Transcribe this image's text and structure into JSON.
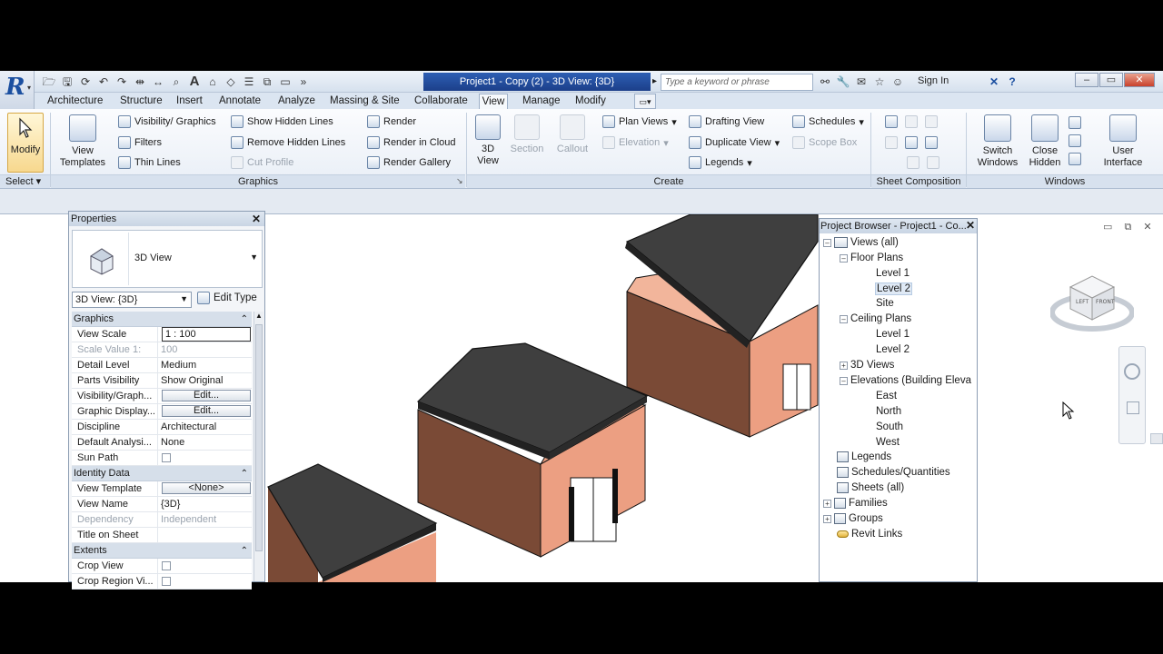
{
  "window": {
    "doc_title": "Project1 - Copy (2) - 3D View: {3D}",
    "search_placeholder": "Type a keyword or phrase",
    "signin": "Sign In"
  },
  "ribbon": {
    "tabs": [
      "Architecture",
      "Structure",
      "Insert",
      "Annotate",
      "Analyze",
      "Massing & Site",
      "Collaborate",
      "View",
      "Manage",
      "Modify"
    ],
    "select": {
      "modify": "Modify",
      "select_label": "Select"
    },
    "graphics": {
      "view_templates": "View Templates",
      "visibility_graphics": "Visibility/ Graphics",
      "filters": "Filters",
      "thin_lines": "Thin  Lines",
      "show_hidden_lines": "Show  Hidden Lines",
      "remove_hidden_lines": "Remove  Hidden Lines",
      "cut_profile": "Cut  Profile",
      "render": "Render",
      "render_in_cloud": "Render  in Cloud",
      "render_gallery": "Render  Gallery",
      "title": "Graphics"
    },
    "create": {
      "view3d": "3D View",
      "section": "Section",
      "callout": "Callout",
      "plan_views": "Plan  Views",
      "elevation": "Elevation",
      "legends": "Legends",
      "drafting_view": "Drafting  View",
      "duplicate_view": "Duplicate  View",
      "schedules": "Schedules",
      "scope_box": "Scope  Box",
      "title": "Create"
    },
    "sheet_composition": {
      "title": "Sheet Composition"
    },
    "windows": {
      "switch_windows": "Switch Windows",
      "close_hidden": "Close Hidden",
      "user_interface": "User Interface",
      "title": "Windows"
    }
  },
  "properties": {
    "title": "Properties",
    "type_name": "3D View",
    "view_combo": "3D View: {3D}",
    "edit_type": "Edit Type",
    "groups": [
      {
        "name": "Graphics",
        "rows": [
          {
            "k": "View Scale",
            "v": "1 : 100",
            "kind": "field"
          },
          {
            "k": "Scale Value    1:",
            "v": "100",
            "kind": "dis"
          },
          {
            "k": "Detail Level",
            "v": "Medium"
          },
          {
            "k": "Parts Visibility",
            "v": "Show Original"
          },
          {
            "k": "Visibility/Graph...",
            "v": "Edit...",
            "kind": "btn"
          },
          {
            "k": "Graphic Display...",
            "v": "Edit...",
            "kind": "btn"
          },
          {
            "k": "Discipline",
            "v": "Architectural"
          },
          {
            "k": "Default Analysi...",
            "v": "None"
          },
          {
            "k": "Sun Path",
            "v": "",
            "kind": "cb"
          }
        ]
      },
      {
        "name": "Identity Data",
        "rows": [
          {
            "k": "View Template",
            "v": "<None>",
            "kind": "btn"
          },
          {
            "k": "View Name",
            "v": "{3D}"
          },
          {
            "k": "Dependency",
            "v": "Independent",
            "kind": "dis"
          },
          {
            "k": "Title on Sheet",
            "v": ""
          }
        ]
      },
      {
        "name": "Extents",
        "rows": [
          {
            "k": "Crop View",
            "v": "",
            "kind": "cb"
          },
          {
            "k": "Crop Region Vi...",
            "v": "",
            "kind": "cb"
          }
        ]
      }
    ]
  },
  "browser": {
    "title": "Project Browser - Project1 - Co...",
    "views_all": "Views (all)",
    "floor_plans": "Floor Plans",
    "fp_level1": "Level 1",
    "fp_level2": "Level 2",
    "fp_site": "Site",
    "ceiling_plans": "Ceiling Plans",
    "cp_level1": "Level 1",
    "cp_level2": "Level 2",
    "views3d": "3D Views",
    "elevations": "Elevations (Building Eleva",
    "east": "East",
    "north": "North",
    "south": "South",
    "west": "West",
    "legends": "Legends",
    "schedules": "Schedules/Quantities",
    "sheets": "Sheets (all)",
    "families": "Families",
    "groups": "Groups",
    "revit_links": "Revit Links"
  },
  "viewcube": {
    "left": "LEFT",
    "front": "FRONT"
  }
}
